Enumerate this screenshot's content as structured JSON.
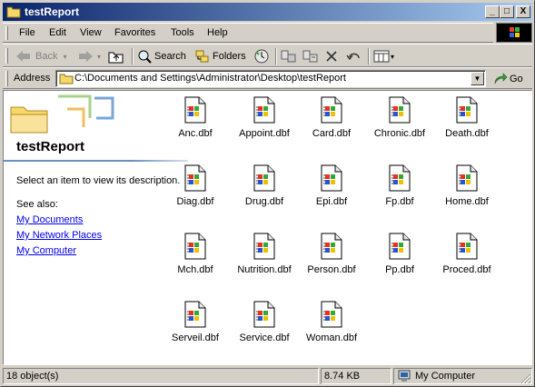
{
  "window": {
    "title": "testReport"
  },
  "title_buttons": {
    "minimize": "_",
    "maximize": "□",
    "close": "X"
  },
  "menu": [
    "File",
    "Edit",
    "View",
    "Favorites",
    "Tools",
    "Help"
  ],
  "toolbar": {
    "back": "Back",
    "search": "Search",
    "folders": "Folders"
  },
  "address": {
    "label": "Address",
    "value": "C:\\Documents and Settings\\Administrator\\Desktop\\testReport",
    "go": "Go"
  },
  "left_panel": {
    "title": "testReport",
    "description": "Select an item to view its description.",
    "see_also": "See also:",
    "links": [
      "My Documents",
      "My Network Places",
      "My Computer"
    ]
  },
  "files": [
    "Anc.dbf",
    "Appoint.dbf",
    "Card.dbf",
    "Chronic.dbf",
    "Death.dbf",
    "Diag.dbf",
    "Drug.dbf",
    "Epi.dbf",
    "Fp.dbf",
    "Home.dbf",
    "Mch.dbf",
    "Nutrition.dbf",
    "Person.dbf",
    "Pp.dbf",
    "Proced.dbf",
    "Serveil.dbf",
    "Service.dbf",
    "Woman.dbf"
  ],
  "status": {
    "objects": "18 object(s)",
    "size": "8.74 KB",
    "zone": "My Computer"
  }
}
